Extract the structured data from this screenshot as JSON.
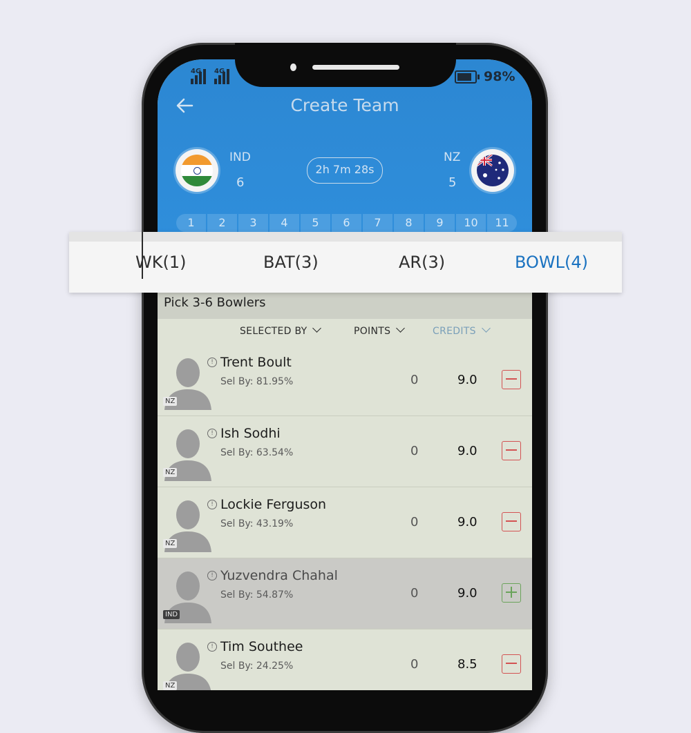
{
  "status_bar": {
    "signal_1": "4G",
    "signal_2": "4G",
    "battery_percent": "98%"
  },
  "header": {
    "title": "Create Team"
  },
  "match": {
    "team1": {
      "code": "IND",
      "count": "6"
    },
    "team2": {
      "code": "NZ",
      "count": "5"
    },
    "timer": "2h 7m 28s"
  },
  "slots": [
    "1",
    "2",
    "3",
    "4",
    "5",
    "6",
    "7",
    "8",
    "9",
    "10",
    "11"
  ],
  "tabs": [
    {
      "label": "WK(1)"
    },
    {
      "label": "BAT(3)"
    },
    {
      "label": "AR(3)"
    },
    {
      "label": "BOWL(4)"
    }
  ],
  "pick_text": "Pick 3-6 Bowlers",
  "sort": {
    "selected_by": "SELECTED BY",
    "points": "POINTS",
    "credits": "CREDITS"
  },
  "players": [
    {
      "name": "Trent Boult",
      "sel_by": "Sel By: 81.95%",
      "points": "0",
      "credits": "9.0",
      "team": "NZ",
      "selected": true
    },
    {
      "name": "Ish Sodhi",
      "sel_by": "Sel By: 63.54%",
      "points": "0",
      "credits": "9.0",
      "team": "NZ",
      "selected": true
    },
    {
      "name": "Lockie Ferguson",
      "sel_by": "Sel By: 43.19%",
      "points": "0",
      "credits": "9.0",
      "team": "NZ",
      "selected": true
    },
    {
      "name": "Yuzvendra Chahal",
      "sel_by": "Sel By: 54.87%",
      "points": "0",
      "credits": "9.0",
      "team": "IND",
      "selected": false
    },
    {
      "name": "Tim Southee",
      "sel_by": "Sel By: 24.25%",
      "points": "0",
      "credits": "8.5",
      "team": "NZ",
      "selected": true
    }
  ],
  "icons": [
    "back-arrow-icon",
    "india-flag-icon",
    "australia-flag-icon",
    "info-icon",
    "avatar-silhouette-icon",
    "remove-icon",
    "add-icon",
    "chevron-down-icon",
    "battery-icon",
    "signal-icon"
  ],
  "colors": {
    "header_blue": "#2f8edb",
    "active_tab": "#1a72c0",
    "remove_red": "#d35252",
    "add_green": "#6aa35a"
  }
}
